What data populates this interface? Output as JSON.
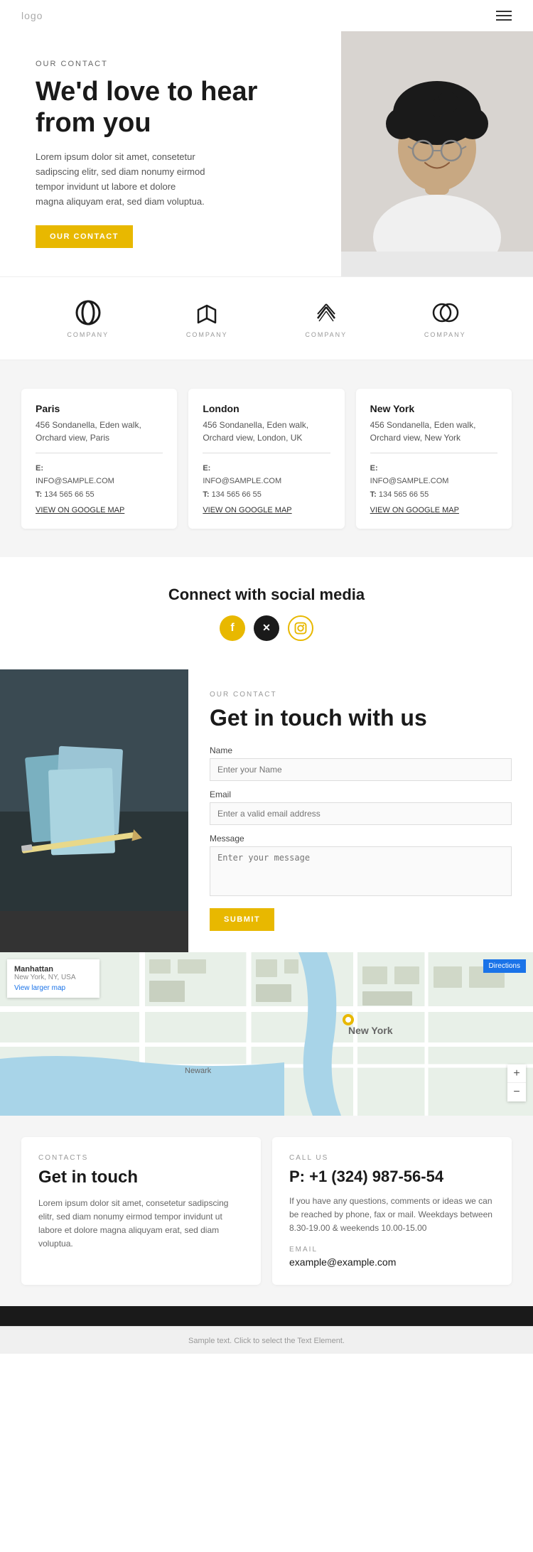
{
  "header": {
    "logo": "logo",
    "menu_icon": "☰"
  },
  "hero": {
    "tag": "OUR CONTACT",
    "title": "We'd love to hear from you",
    "description": "Lorem ipsum dolor sit amet, consetetur sadipscing elitr, sed diam nonumy eirmod tempor invidunt ut labore et dolore magna aliquyam erat, sed diam voluptua.",
    "cta_label": "OUR CONTACT"
  },
  "logos": [
    {
      "label": "COMPANY"
    },
    {
      "label": "COMPANY"
    },
    {
      "label": "COMPANY"
    },
    {
      "label": "COMPANY"
    }
  ],
  "offices": [
    {
      "city": "Paris",
      "address": "456 Sondanella, Eden walk, Orchard view, Paris",
      "email_label": "E:",
      "email": "INFO@SAMPLE.COM",
      "phone_label": "T:",
      "phone": "134 565 66 55",
      "map_link": "VIEW ON GOOGLE MAP"
    },
    {
      "city": "London",
      "address": "456 Sondanella, Eden walk, Orchard view, London, UK",
      "email_label": "E:",
      "email": "INFO@SAMPLE.COM",
      "phone_label": "T:",
      "phone": "134 565 66 55",
      "map_link": "VIEW ON GOOGLE MAP"
    },
    {
      "city": "New York",
      "address": "456 Sondanella, Eden walk, Orchard view, New York",
      "email_label": "E:",
      "email": "INFO@SAMPLE.COM",
      "phone_label": "T:",
      "phone": "134 565 66 55",
      "map_link": "VIEW ON GOOGLE MAP"
    }
  ],
  "social": {
    "title": "Connect with social media",
    "icons": [
      "f",
      "X",
      "◎"
    ]
  },
  "contact_form": {
    "tag": "OUR CONTACT",
    "title": "Get in touch with us",
    "name_label": "Name",
    "name_placeholder": "Enter your Name",
    "email_label": "Email",
    "email_placeholder": "Enter a valid email address",
    "message_label": "Message",
    "message_placeholder": "Enter your message",
    "submit_label": "SUBMIT"
  },
  "map": {
    "location": "Manhattan",
    "sub": "New York, NY, USA",
    "link": "View larger map",
    "directions": "Directions"
  },
  "bottom_contacts": {
    "left": {
      "tag": "CONTACTS",
      "title": "Get in touch",
      "description": "Lorem ipsum dolor sit amet, consetetur sadipscing elitr, sed diam nonumy eirmod tempor invidunt ut labore et dolore magna aliquyam erat, sed diam voluptua."
    },
    "right": {
      "tag": "CALL US",
      "phone": "P: +1 (324) 987-56-54",
      "description": "If you have any questions, comments or ideas we can be reached by phone, fax or mail. Weekdays between 8.30-19.00 & weekends 10.00-15.00",
      "email_tag": "EMAIL",
      "email": "example@example.com"
    }
  },
  "footer": {
    "sample_text": "Sample text. Click to select the Text Element."
  }
}
